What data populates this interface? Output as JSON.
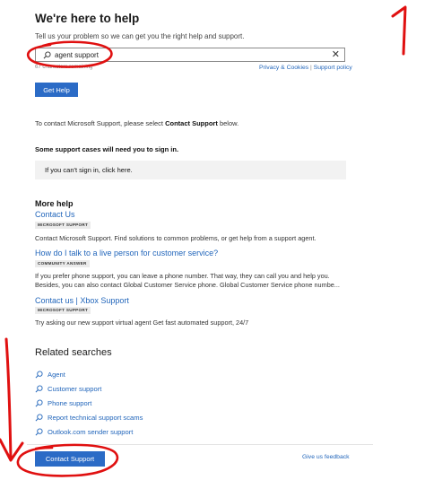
{
  "header": {
    "title": "We're here to help",
    "intro": "Tell us your problem so we can get you the right help and support."
  },
  "search": {
    "value": "agent support",
    "char_count": "67 characters remaining",
    "clear_icon": "close-icon"
  },
  "policy_links": {
    "privacy": "Privacy & Cookies",
    "separator": "|",
    "support_policy": "Support policy"
  },
  "get_help_button": "Get Help",
  "contact": {
    "prefix": "To contact Microsoft Support, please select",
    "bold": "Contact Support",
    "suffix": "below."
  },
  "signin": {
    "note": "Some support cases will need you to sign in.",
    "box": "If you can't sign in, click here."
  },
  "more_help": {
    "heading": "More help",
    "items": [
      {
        "title": "Contact Us",
        "tag": "MICROSOFT SUPPORT",
        "desc": "Contact Microsoft Support. Find solutions to common problems, or get help from a support agent."
      },
      {
        "title": "How do I talk to a live person for customer service?",
        "tag": "COMMUNITY ANSWER",
        "desc": "If you prefer phone support, you can leave a phone number. That way, they can call you and help you.",
        "desc2": "Besides, you can also contact Global Customer Service phone. Global Customer Service phone numbe..."
      },
      {
        "title": "Contact us | Xbox Support",
        "tag": "MICROSOFT SUPPORT",
        "desc": "Try asking our new support virtual agent Get fast automated support, 24/7"
      }
    ]
  },
  "related": {
    "heading": "Related searches",
    "items": [
      "Agent",
      "Customer support",
      "Phone support",
      "Report technical support scams",
      "Outlook.com sender support"
    ]
  },
  "footer": {
    "contact_button": "Contact Support",
    "feedback": "Give us feedback"
  },
  "annotations": {
    "number": "1"
  },
  "colors": {
    "accent": "#2b6bc6",
    "link": "#2266bb",
    "annotation": "#e01010"
  }
}
